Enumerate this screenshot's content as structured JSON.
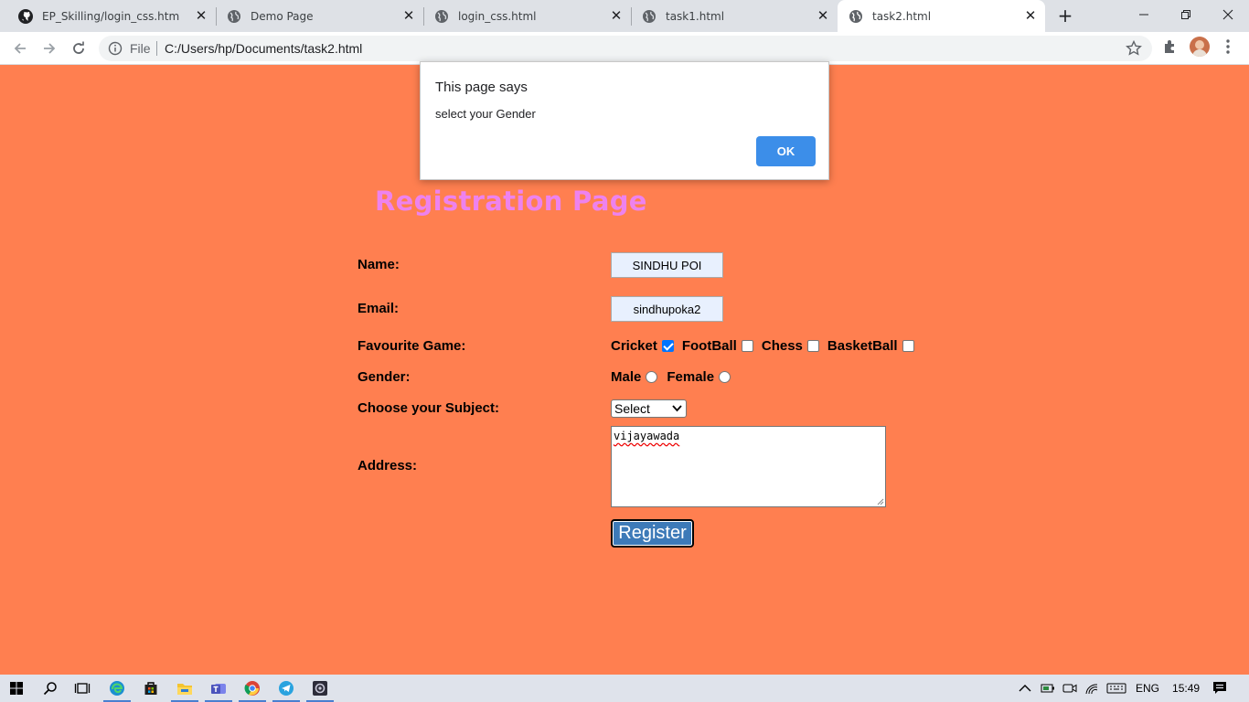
{
  "browser": {
    "tabs": [
      {
        "title": "EP_Skilling/login_css.html at m",
        "icon": "github-icon",
        "active": false
      },
      {
        "title": "Demo Page",
        "icon": "globe-icon",
        "active": false
      },
      {
        "title": "login_css.html",
        "icon": "globe-icon",
        "active": false
      },
      {
        "title": "task1.html",
        "icon": "globe-icon",
        "active": false
      },
      {
        "title": "task2.html",
        "icon": "globe-icon",
        "active": true
      }
    ],
    "address": {
      "scheme_label": "File",
      "url": "C:/Users/hp/Documents/task2.html"
    }
  },
  "page": {
    "heading": "Registration Page",
    "background_color": "#ff7f50",
    "heading_color": "#ee82ee",
    "name": {
      "label": "Name:",
      "value": "SINDHU POI"
    },
    "email": {
      "label": "Email:",
      "value": "sindhupoka2"
    },
    "game": {
      "label": "Favourite Game:",
      "options": [
        {
          "label": "Cricket",
          "checked": true
        },
        {
          "label": "FootBall",
          "checked": false
        },
        {
          "label": "Chess",
          "checked": false
        },
        {
          "label": "BasketBall",
          "checked": false
        }
      ]
    },
    "gender": {
      "label": "Gender:",
      "options": [
        {
          "label": "Male",
          "selected": false
        },
        {
          "label": "Female",
          "selected": false
        }
      ]
    },
    "subject": {
      "label": "Choose your Subject:",
      "selected": "Select"
    },
    "address": {
      "label": "Address:",
      "value": "vijayawada"
    },
    "register_label": "Register"
  },
  "dialog": {
    "title": "This page says",
    "message": "select your Gender",
    "ok_label": "OK"
  },
  "taskbar": {
    "apps": [
      "windows-start-icon",
      "search-icon",
      "task-view-icon",
      "edge-icon",
      "store-icon",
      "file-explorer-icon",
      "teams-icon",
      "chrome-icon",
      "telegram-icon",
      "app-icon"
    ],
    "language": "ENG",
    "time": "15:49"
  }
}
